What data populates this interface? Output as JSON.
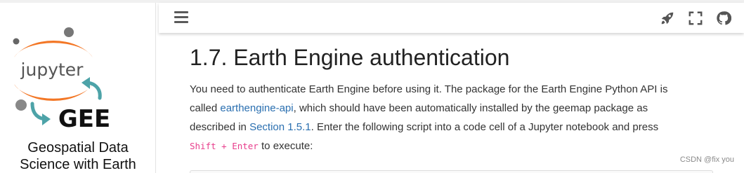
{
  "sidebar": {
    "logo": {
      "text_top": "jupyter",
      "text_bottom": "GEE"
    },
    "title_line1": "Geospatial Data",
    "title_line2": "Science with Earth"
  },
  "header": {
    "menu_icon": "hamburger-menu-icon",
    "icons": [
      "rocket-icon",
      "fullscreen-icon",
      "github-icon"
    ]
  },
  "main": {
    "title": "1.7. Earth Engine authentication",
    "p1": "You need to authenticate Earth Engine before using it. The package for the Earth Engine Python API is",
    "p2_pre": "called ",
    "p2_link": "earthengine-api",
    "p2_post": ", which should have been automatically installed by the geemap package as",
    "p3_pre": "described in ",
    "p3_link": "Section 1.5.1",
    "p3_post": ". Enter the following script into a code cell of a Jupyter notebook and press",
    "p4_code": "Shift + Enter",
    "p4_post": " to execute:"
  },
  "watermark": "CSDN @fix you",
  "colors": {
    "orange": "#F37726",
    "teal": "#4DA3A8",
    "link": "#2a6fb0",
    "code": "#e83e8c"
  }
}
